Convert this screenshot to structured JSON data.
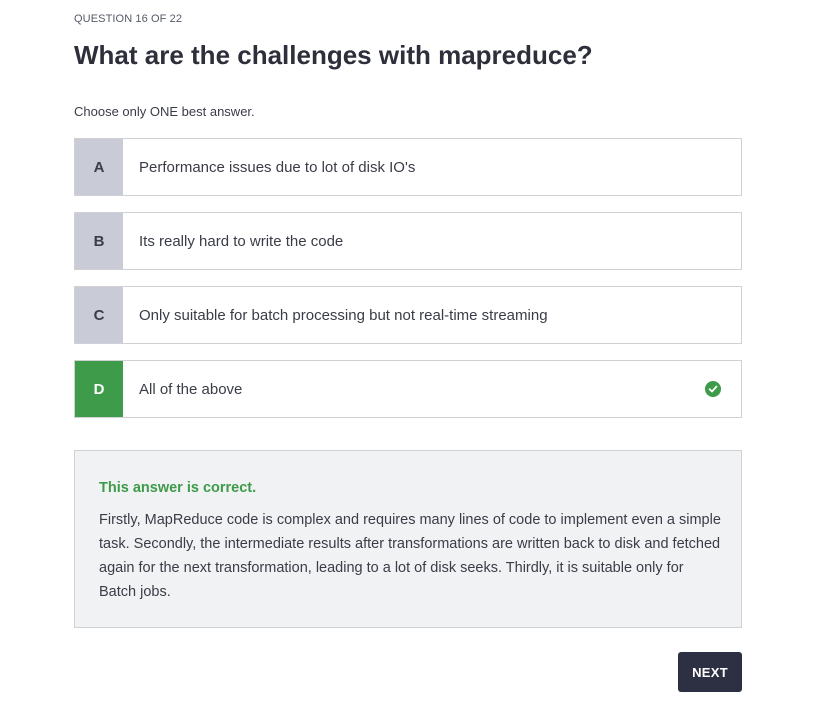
{
  "quiz": {
    "counter": "QUESTION 16 OF 22",
    "question": "What are the challenges with mapreduce?",
    "instruction": "Choose only ONE best answer."
  },
  "options": [
    {
      "letter": "A",
      "text": "Performance issues due to lot of disk IO's"
    },
    {
      "letter": "B",
      "text": "Its really hard to write the code"
    },
    {
      "letter": "C",
      "text": "Only suitable for batch processing but not real-time streaming"
    },
    {
      "letter": "D",
      "text": "All of the above",
      "selected": true,
      "icon": "check-circle-icon"
    }
  ],
  "feedback": {
    "verdict": "This answer is correct.",
    "explanation": "Firstly, MapReduce code is complex and requires many lines of code to implement even a simple task. Secondly, the intermediate results after transformations are written back to disk and fetched again for the next transformation, leading to a lot of disk seeks. Thirdly, it is suitable only for Batch jobs."
  },
  "actions": {
    "next_label": "NEXT"
  },
  "colors": {
    "correct": "#3d9b4a",
    "letter_bg": "#c9ccd6",
    "button_bg": "#2d2f42",
    "feedback_bg": "#f1f2f4"
  }
}
